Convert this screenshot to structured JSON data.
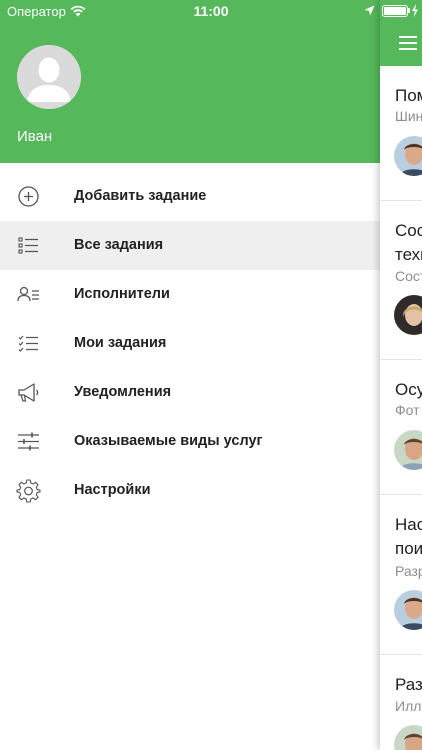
{
  "status_bar": {
    "carrier": "Оператор",
    "time": "11:00"
  },
  "drawer": {
    "user_name": "Иван",
    "menu": [
      {
        "label": "Добавить задание",
        "icon": "add-circle-icon",
        "active": false
      },
      {
        "label": "Все задания",
        "icon": "list-icon",
        "active": true
      },
      {
        "label": "Исполнители",
        "icon": "performers-icon",
        "active": false
      },
      {
        "label": "Мои задания",
        "icon": "checklist-icon",
        "active": false
      },
      {
        "label": "Уведомления",
        "icon": "megaphone-icon",
        "active": false
      },
      {
        "label": "Оказываемые виды услуг",
        "icon": "sliders-icon",
        "active": false
      },
      {
        "label": "Настройки",
        "icon": "gear-icon",
        "active": false
      }
    ]
  },
  "main": {
    "tasks": [
      {
        "title": "Пом",
        "subtitle": "Шин"
      },
      {
        "title": "Сос",
        "title_line2": "техн",
        "subtitle": "Сост"
      },
      {
        "title": "Осу",
        "subtitle": "Фот"
      },
      {
        "title": "Нас",
        "title_line2": "пои",
        "subtitle": "Разр"
      },
      {
        "title": "Раз",
        "subtitle": "Илл"
      }
    ]
  },
  "colors": {
    "accent": "#55b85a",
    "active_row": "#efefef"
  }
}
